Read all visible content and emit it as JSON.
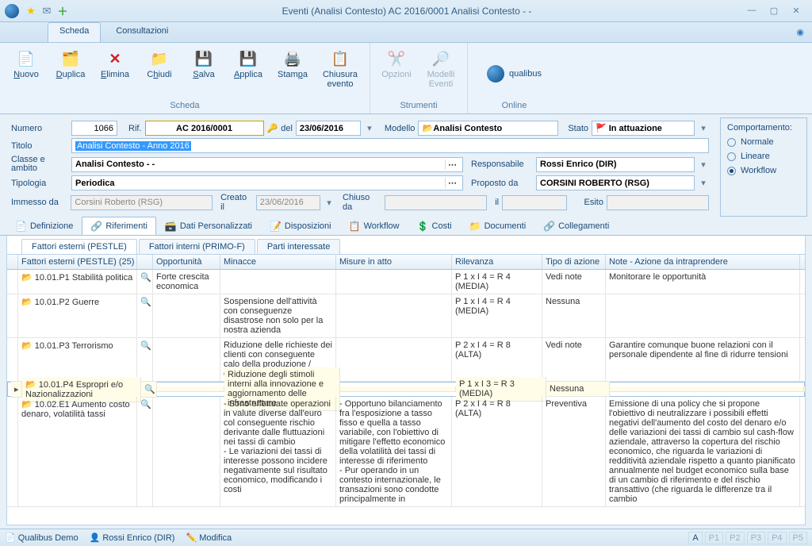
{
  "window": {
    "title": "Eventi (Analisi Contesto)  AC 2016/0001 Analisi Contesto - -"
  },
  "menu": {
    "scheda": "Scheda",
    "consultazioni": "Consultazioni"
  },
  "ribbon": {
    "nuovo": "Nuovo",
    "duplica": "Duplica",
    "elimina": "Elimina",
    "chiudi": "Chiudi",
    "salva": "Salva",
    "applica": "Applica",
    "stampa": "Stampa",
    "chiusura": "Chiusura evento",
    "opzioni": "Opzioni",
    "modelli": "Modelli Eventi",
    "g_scheda": "Scheda",
    "g_strumenti": "Strumenti",
    "g_online": "Online",
    "brand": "qualibus"
  },
  "form": {
    "numero_l": "Numero",
    "numero_v": "1066",
    "rif_l": "Rif.",
    "rif_v": "AC 2016/0001",
    "del_l": "del",
    "del_v": "23/06/2016",
    "modello_l": "Modello",
    "modello_v": "Analisi Contesto",
    "stato_l": "Stato",
    "stato_v": "In attuazione",
    "titolo_l": "Titolo",
    "titolo_v": "Analisi Contesto - Anno 2016",
    "classe_l": "Classe e ambito",
    "classe_v": "Analisi Contesto - -",
    "resp_l": "Responsabile",
    "resp_v": "Rossi Enrico (DIR)",
    "tipologia_l": "Tipologia",
    "tipologia_v": "Periodica",
    "prop_l": "Proposto da",
    "prop_v": "CORSINI ROBERTO (RSG)",
    "imm_l": "Immesso da",
    "imm_v": "Corsini Roberto (RSG)",
    "creato_l": "Creato il",
    "creato_v": "23/06/2016",
    "chiuso_l": "Chiuso da",
    "chiuso_v": "",
    "il_l": "il",
    "il_v": "",
    "esito_l": "Esito",
    "esito_v": ""
  },
  "comport": {
    "title": "Comportamento:",
    "normale": "Normale",
    "lineare": "Lineare",
    "workflow": "Workflow"
  },
  "tabs2": {
    "definizione": "Definizione",
    "riferimenti": "Riferimenti",
    "dati": "Dati Personalizzati",
    "disposizioni": "Disposizioni",
    "workflow": "Workflow",
    "costi": "Costi",
    "documenti": "Documenti",
    "collegamenti": "Collegamenti"
  },
  "subtabs": {
    "pestle": "Fattori esterni (PESTLE)",
    "primof": "Fattori interni (PRIMO-F)",
    "parti": "Parti interessate"
  },
  "grid": {
    "h_fatt": "Fattori esterni (PESTLE) (25)",
    "h_opp": "Opportunità",
    "h_min": "Minacce",
    "h_mis": "Misure in atto",
    "h_ril": "Rilevanza",
    "h_tipo": "Tipo di azione",
    "h_note": "Note - Azione da intraprendere",
    "rows": [
      {
        "f": "10.01.P1 Stabilità politica",
        "opp": "Forte crescita economica",
        "min": "",
        "mis": "",
        "ril": "P 1 x I 4 = R 4 (MEDIA)",
        "tipo": "Vedi note",
        "note": "Monitorare le opportunità"
      },
      {
        "f": "10.01.P2 Guerre",
        "opp": "",
        "min": "Sospensione dell'attività con conseguenze disastrose non solo per la nostra azienda",
        "mis": "",
        "ril": "P 1 x I 4 = R 4 (MEDIA)",
        "tipo": "Nessuna",
        "note": ""
      },
      {
        "f": "10.01.P3 Terrorismo",
        "opp": "",
        "min": "Riduzione delle richieste dei clienti con conseguente calo della produzione / efficienza produttiva",
        "mis": "",
        "ril": "P 2 x I 4 = R 8 (ALTA)",
        "tipo": "Vedi note",
        "note": "Garantire comunque buone relazioni con il personale dipendente al fine di ridurre tensioni"
      },
      {
        "f": "10.01.P4 Espropri e/o Nazionalizzazioni",
        "opp": "",
        "min": "Riduzione degli stimoli interni alla innovazione e aggiornamento delle infrastrutture",
        "mis": "",
        "ril": "P 1 x I 3 = R 3 (MEDIA)",
        "tipo": "Nessuna",
        "note": ""
      },
      {
        "f": "10.02.E1 Aumento costo denaro, volatilità tassi",
        "opp": "",
        "min": "- Sono effettuate operazioni in valute diverse dall'euro col conseguente rischio derivante dalle fluttuazioni nei tassi di cambio\n- Le variazioni dei tassi di interesse possono incidere negativamente sul risultato economico, modificando i costi",
        "mis": "- Opportuno bilanciamento fra l'esposizione a tasso fisso e quella a tasso variabile, con l'obiettivo di mitigare l'effetto economico della volatilità dei tassi di interesse di riferimento\n- Pur operando in un contesto internazionale, le transazioni sono condotte principalmente in",
        "ril": "P 2 x I 4 = R 8 (ALTA)",
        "tipo": "Preventiva",
        "note": "Emissione di una policy che si propone l'obiettivo di neutralizzare i possibili effetti negativi dell'aumento del costo del denaro e/o delle variazioni dei tassi di cambio sul cash-flow aziendale, attraverso la copertura del rischio economico, che riguarda le variazioni di redditività aziendale rispetto a quanto pianificato annualmente nel budget economico sulla base di un cambio di riferimento e del rischio transattivo (che riguarda le differenze tra il cambio"
      }
    ]
  },
  "status": {
    "demo": "Qualibus Demo",
    "user": "Rossi Enrico (DIR)",
    "modifica": "Modifica",
    "a": "A",
    "p1": "P1",
    "p2": "P2",
    "p3": "P3",
    "p4": "P4",
    "p5": "P5"
  }
}
